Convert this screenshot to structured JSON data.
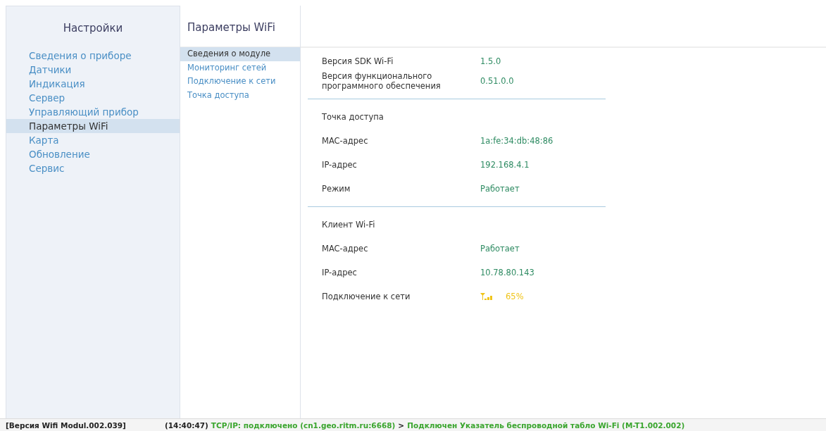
{
  "sidebar": {
    "title": "Настройки",
    "items": [
      {
        "label": "Сведения о приборе",
        "selected": false
      },
      {
        "label": "Датчики",
        "selected": false
      },
      {
        "label": "Индикация",
        "selected": false
      },
      {
        "label": "Сервер",
        "selected": false
      },
      {
        "label": "Управляющий прибор",
        "selected": false
      },
      {
        "label": "Параметры WiFi",
        "selected": true
      },
      {
        "label": "Карта",
        "selected": false
      },
      {
        "label": "Обновление",
        "selected": false
      },
      {
        "label": "Сервис",
        "selected": false
      }
    ]
  },
  "subnav": {
    "title": "Параметры WiFi",
    "items": [
      {
        "label": "Сведения о модуле",
        "selected": true
      },
      {
        "label": "Мониторинг сетей",
        "selected": false
      },
      {
        "label": "Подключение к сети",
        "selected": false
      },
      {
        "label": "Точка доступа",
        "selected": false
      }
    ]
  },
  "sections": [
    {
      "rows": [
        {
          "label": "Версия SDK Wi-Fi",
          "value": "1.5.0",
          "kind": "text"
        },
        {
          "label": "Версия функционального программного обеспечения",
          "value": "0.51.0.0",
          "kind": "text"
        }
      ]
    },
    {
      "title": "Точка доступа",
      "rows": [
        {
          "label": "MAC-адрес",
          "value": "1a:fe:34:db:48:86",
          "kind": "text"
        },
        {
          "label": "IP-адрес",
          "value": "192.168.4.1",
          "kind": "text"
        },
        {
          "label": "Режим",
          "value": "Работает",
          "kind": "text"
        }
      ]
    },
    {
      "title": "Клиент Wi-Fi",
      "rows": [
        {
          "label": "MAC-адрес",
          "value": "Работает",
          "kind": "text"
        },
        {
          "label": "IP-адрес",
          "value": "10.78.80.143",
          "kind": "text"
        },
        {
          "label": "Подключение к сети",
          "value": "65%",
          "kind": "signal"
        }
      ]
    }
  ],
  "status_bar": {
    "version": "[Версия Wifi Modul.002.039]",
    "segments": [
      {
        "text": "(14:40:47)",
        "kind": "plain"
      },
      {
        "text": "TCP/IP: подключено (cn1.geo.ritm.ru:6668)",
        "kind": "ok"
      },
      {
        "text": ">",
        "kind": "plain"
      },
      {
        "text": "Подключен Указатель беспроводной табло Wi-Fi (M-T1.002.002)",
        "kind": "ok"
      }
    ]
  }
}
